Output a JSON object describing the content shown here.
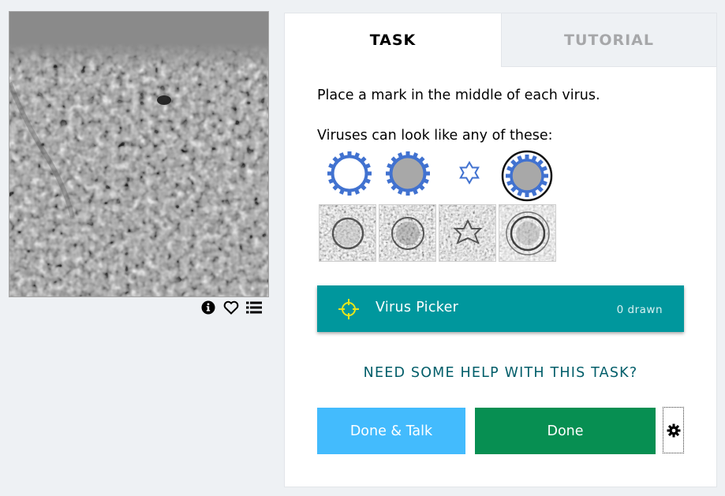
{
  "tabs": {
    "task": "TASK",
    "tutorial": "TUTORIAL"
  },
  "task": {
    "instruction": "Place a mark in the middle of each virus.",
    "help_text": "Viruses can look like any of these:",
    "examples": {
      "glyph_icons": [
        "virus-outline-icon",
        "virus-filled-icon",
        "virus-star-icon",
        "virus-ringed-icon"
      ],
      "photo_count": 4
    }
  },
  "tool": {
    "label": "Virus Picker",
    "count_text": "0 drawn",
    "icon": "crosshair-icon",
    "color": "#00979d",
    "icon_color": "#e6e61a"
  },
  "help_link": "NEED SOME HELP WITH THIS TASK?",
  "buttons": {
    "done_talk": "Done & Talk",
    "done": "Done",
    "settings_icon": "gear-icon"
  },
  "meta_tools": [
    "info-icon",
    "heart-icon",
    "list-icon"
  ],
  "colors": {
    "background": "#eef1f4",
    "done_talk": "#43bbfd",
    "done": "#078f52",
    "help_link": "#005d69",
    "virus_blue": "#4172d0"
  }
}
